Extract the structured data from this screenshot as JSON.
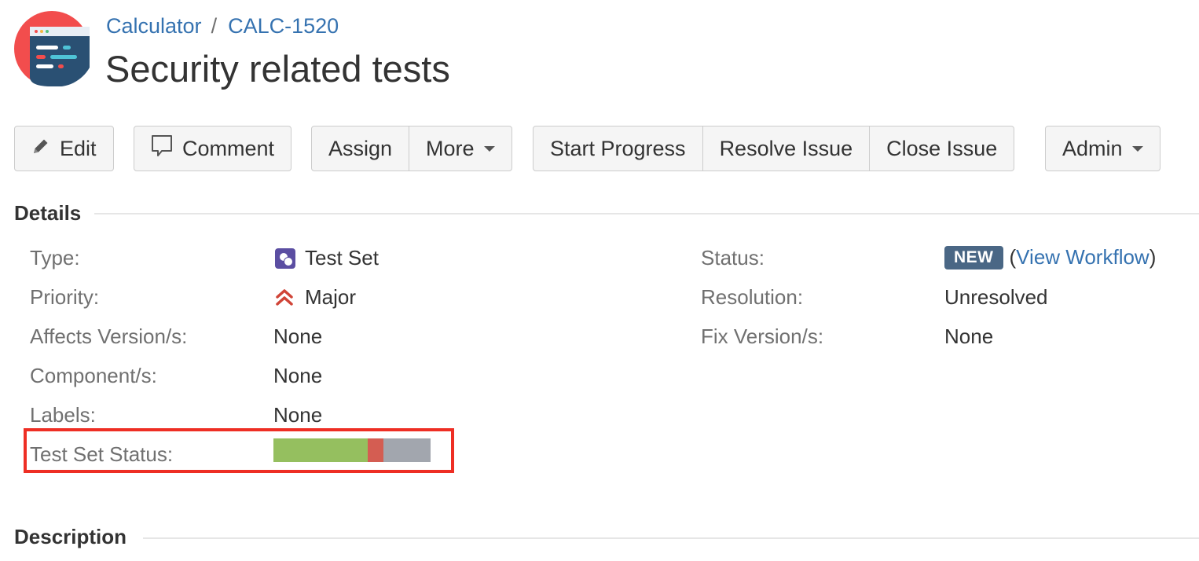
{
  "header": {
    "breadcrumb": {
      "project": "Calculator",
      "separator": "/",
      "issue_key": "CALC-1520"
    },
    "title": "Security related tests"
  },
  "toolbar": {
    "edit": "Edit",
    "comment": "Comment",
    "assign": "Assign",
    "more": "More",
    "start_progress": "Start Progress",
    "resolve_issue": "Resolve Issue",
    "close_issue": "Close Issue",
    "admin": "Admin"
  },
  "details": {
    "heading": "Details",
    "left": [
      {
        "label": "Type:",
        "value": "Test Set",
        "icon": "test-set-icon"
      },
      {
        "label": "Priority:",
        "value": "Major",
        "icon": "priority-major-icon"
      },
      {
        "label": "Affects Version/s:",
        "value": "None"
      },
      {
        "label": "Component/s:",
        "value": "None"
      },
      {
        "label": "Labels:",
        "value": "None"
      },
      {
        "label": "Test Set Status:"
      }
    ],
    "right": [
      {
        "label": "Status:",
        "badge": "NEW",
        "paren_open": "(",
        "link": "View Workflow",
        "paren_close": ")"
      },
      {
        "label": "Resolution:",
        "value": "Unresolved"
      },
      {
        "label": "Fix Version/s:",
        "value": "None"
      }
    ],
    "test_set_status": {
      "segments": [
        {
          "status": "passed",
          "fraction": 0.6,
          "color": "#95bf5f"
        },
        {
          "status": "failed",
          "fraction": 0.1,
          "color": "#d45d52"
        },
        {
          "status": "todo",
          "fraction": 0.3,
          "color": "#a2a6ae"
        }
      ]
    }
  },
  "description": {
    "heading": "Description"
  },
  "colors": {
    "link": "#3572b0",
    "status_badge": "#4a6785",
    "highlight": "#ee2e24"
  }
}
